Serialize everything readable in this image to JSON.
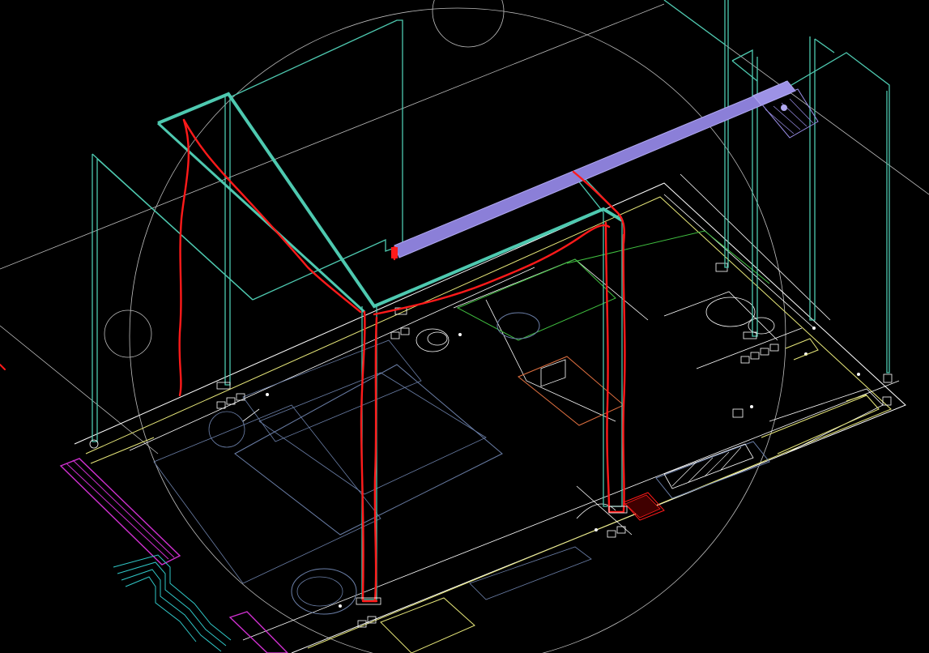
{
  "drawing": {
    "background": "#000000",
    "colors": {
      "duct": "#4ec9b0",
      "pipe": "#9b8fe8",
      "markup": "#ff1a1a",
      "outline": "#e8e87a",
      "wall": "#ffffff",
      "furniture": "#6b7fa8",
      "magenta": "#d030d0",
      "green": "#40c040",
      "cyan": "#30c8c8",
      "guide": "#bfbfbf"
    },
    "views": {
      "isometric_3d": true,
      "grid": false,
      "legend": false
    }
  },
  "annotations": {
    "tags": []
  }
}
